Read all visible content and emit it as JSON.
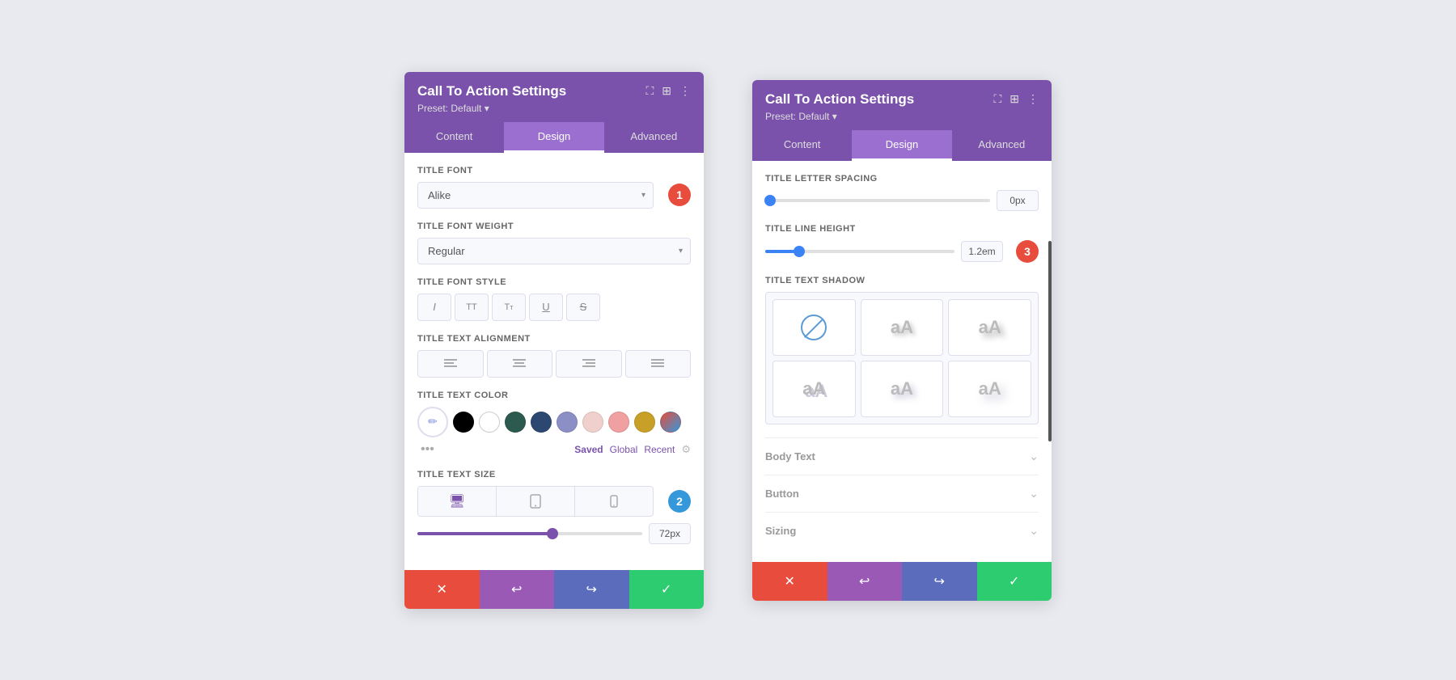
{
  "panels": [
    {
      "id": "left",
      "title": "Call To Action Settings",
      "preset": "Preset: Default ▾",
      "tabs": [
        {
          "label": "Content",
          "active": false
        },
        {
          "label": "Design",
          "active": true
        },
        {
          "label": "Advanced",
          "active": false
        }
      ],
      "step_badge": "1",
      "step_badge2": "2",
      "fields": {
        "title_font_label": "Title Font",
        "title_font_value": "Alike",
        "title_font_weight_label": "Title Font Weight",
        "title_font_weight_value": "Regular",
        "title_font_style_label": "Title Font Style",
        "title_text_align_label": "Title Text Alignment",
        "title_text_color_label": "Title Text Color",
        "title_text_size_label": "Title Text Size",
        "slider_value": "72px",
        "slider_percent": 60
      },
      "colors": [
        "#000000",
        "#ffffff",
        "#2d5a4e",
        "#2c4870",
        "#8b8fc5",
        "#f0d0cc",
        "#f0a0a0",
        "#c8a028"
      ],
      "footer": {
        "cancel": "✕",
        "undo": "↩",
        "redo": "↪",
        "confirm": "✓"
      }
    },
    {
      "id": "right",
      "title": "Call To Action Settings",
      "preset": "Preset: Default ▾",
      "tabs": [
        {
          "label": "Content",
          "active": false
        },
        {
          "label": "Design",
          "active": true
        },
        {
          "label": "Advanced",
          "active": false
        }
      ],
      "step_badge3": "3",
      "fields": {
        "title_letter_spacing_label": "Title Letter Spacing",
        "letter_spacing_value": "0px",
        "letter_spacing_percent": 2,
        "title_line_height_label": "Title Line Height",
        "line_height_value": "1.2em",
        "line_height_percent": 18,
        "title_text_shadow_label": "Title Text Shadow"
      },
      "collapsible": [
        {
          "label": "Body Text"
        },
        {
          "label": "Button"
        },
        {
          "label": "Sizing"
        }
      ],
      "footer": {
        "cancel": "✕",
        "undo": "↩",
        "redo": "↪",
        "confirm": "✓"
      }
    }
  ],
  "icons": {
    "eyedropper": "✏",
    "italic": "I",
    "caps": "TT",
    "small_caps": "Tт",
    "underline": "U",
    "strikethrough": "S",
    "align_left": "≡",
    "align_center": "≡",
    "align_right": "≡",
    "align_justify": "≡",
    "desktop": "🖥",
    "tablet": "⬜",
    "mobile": "📱",
    "chevron_down": "⌄",
    "more_vert": "⋮",
    "fullscreen": "⛶",
    "grid": "⊞"
  }
}
